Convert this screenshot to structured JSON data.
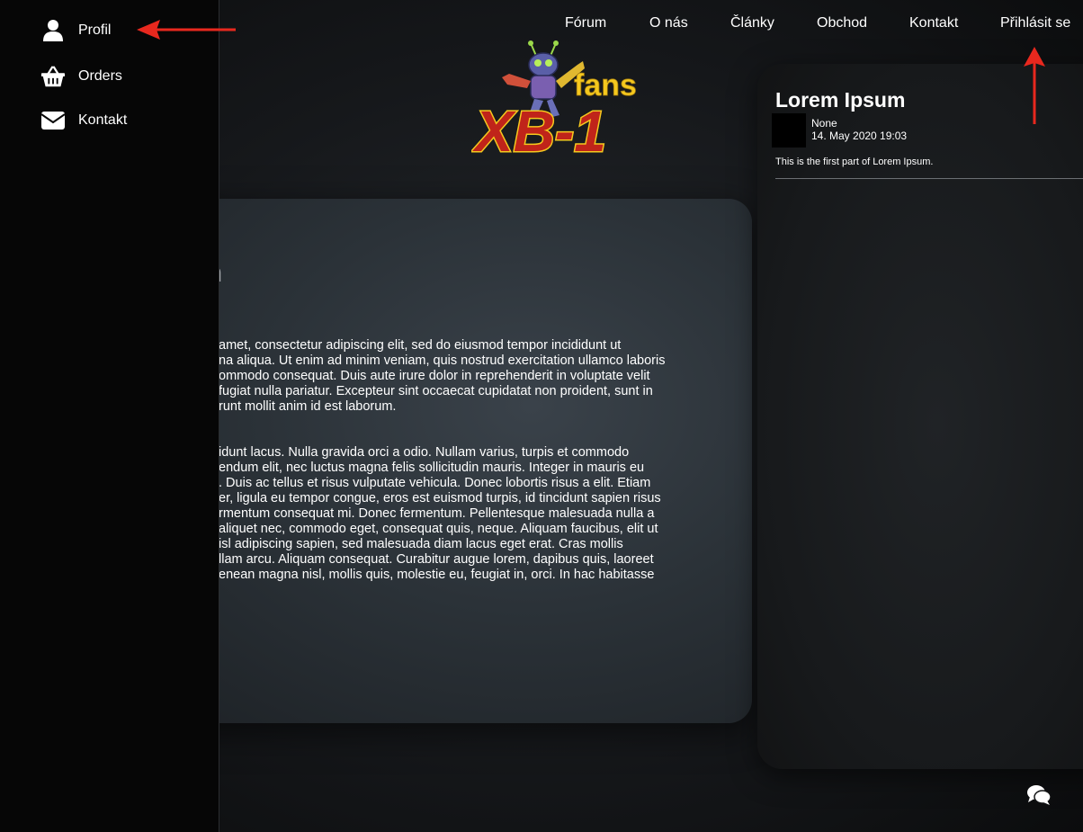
{
  "sidebar": {
    "items": [
      {
        "label": "Profil",
        "icon": "user-icon"
      },
      {
        "label": "Orders",
        "icon": "basket-icon"
      },
      {
        "label": "Kontakt",
        "icon": "envelope-icon"
      }
    ]
  },
  "nav": {
    "items": [
      "Fórum",
      "O nás",
      "Články",
      "Obchod",
      "Kontakt",
      "Přihlásit se"
    ]
  },
  "logo": {
    "top_text": "fans",
    "main_text": "XB-1"
  },
  "article": {
    "title": "um",
    "paragraph1": [
      " amet, consectetur adipiscing elit, sed do eiusmod tempor incididunt ut",
      "na aliqua. Ut enim ad minim veniam, quis nostrud exercitation ullamco laboris",
      "ommodo consequat. Duis aute irure dolor in reprehenderit in voluptate velit",
      " fugiat nulla pariatur. Excepteur sint occaecat cupidatat non proident, sunt in",
      "runt mollit anim id est laborum."
    ],
    "paragraph2": [
      "idunt lacus. Nulla gravida orci a odio. Nullam varius, turpis et commodo",
      "endum elit, nec luctus magna felis sollicitudin mauris. Integer in mauris eu",
      ". Duis ac tellus et risus vulputate vehicula. Donec lobortis risus a elit. Etiam",
      "er, ligula eu tempor congue, eros est euismod turpis, id tincidunt sapien risus",
      "rmentum consequat mi. Donec fermentum. Pellentesque malesuada nulla a",
      "aliquet nec, commodo eget, consequat quis, neque. Aliquam faucibus, elit ut",
      "isl adipiscing sapien, sed malesuada diam lacus eget erat. Cras mollis",
      "llam arcu. Aliquam consequat. Curabitur augue lorem, dapibus quis, laoreet",
      "enean magna nisl, mollis quis, molestie eu, feugiat in, orci. In hac habitasse"
    ]
  },
  "news": {
    "title": "Lorem Ipsum",
    "author": "None",
    "date": "14. May 2020 19:03",
    "excerpt": "This is the first part of Lorem Ipsum."
  },
  "colors": {
    "annotation_arrow": "#e8281e",
    "logo_yellow": "#f5c81e",
    "logo_red": "#c0241a"
  }
}
